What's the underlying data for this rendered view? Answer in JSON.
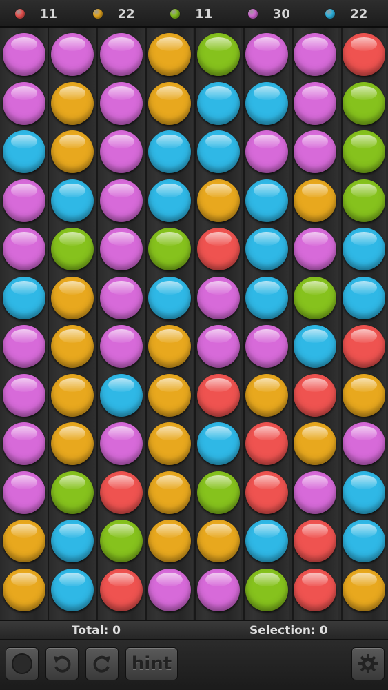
{
  "colors": {
    "red": "#ef5350",
    "orange": "#e8a81e",
    "green": "#86c21d",
    "pink": "#d76ad9",
    "blue": "#2fb8e6"
  },
  "counters": [
    {
      "color": "red",
      "value": "11"
    },
    {
      "color": "orange",
      "value": "22"
    },
    {
      "color": "green",
      "value": "11"
    },
    {
      "color": "pink",
      "value": "30"
    },
    {
      "color": "blue",
      "value": "22"
    }
  ],
  "board": [
    [
      "pink",
      "pink",
      "pink",
      "orange",
      "green",
      "pink",
      "pink",
      "red"
    ],
    [
      "pink",
      "orange",
      "pink",
      "orange",
      "blue",
      "blue",
      "pink",
      "green"
    ],
    [
      "blue",
      "orange",
      "pink",
      "blue",
      "blue",
      "pink",
      "pink",
      "green"
    ],
    [
      "pink",
      "blue",
      "pink",
      "blue",
      "orange",
      "blue",
      "orange",
      "green"
    ],
    [
      "pink",
      "green",
      "pink",
      "green",
      "red",
      "blue",
      "pink",
      "blue"
    ],
    [
      "blue",
      "orange",
      "pink",
      "blue",
      "pink",
      "blue",
      "green",
      "blue"
    ],
    [
      "pink",
      "orange",
      "pink",
      "orange",
      "pink",
      "pink",
      "blue",
      "red"
    ],
    [
      "pink",
      "orange",
      "blue",
      "orange",
      "red",
      "orange",
      "red",
      "orange"
    ],
    [
      "pink",
      "orange",
      "pink",
      "orange",
      "blue",
      "red",
      "orange",
      "pink"
    ],
    [
      "pink",
      "green",
      "red",
      "orange",
      "green",
      "red",
      "pink",
      "blue"
    ],
    [
      "orange",
      "blue",
      "green",
      "orange",
      "orange",
      "blue",
      "red",
      "blue"
    ],
    [
      "orange",
      "blue",
      "red",
      "pink",
      "pink",
      "green",
      "red",
      "orange"
    ]
  ],
  "status": {
    "total": "Total: 0",
    "selection": "Selection: 0"
  },
  "toolbar": {
    "hint_label": "hint",
    "icons": [
      "circle-icon",
      "undo-icon",
      "redo-icon",
      "gear-icon"
    ]
  }
}
